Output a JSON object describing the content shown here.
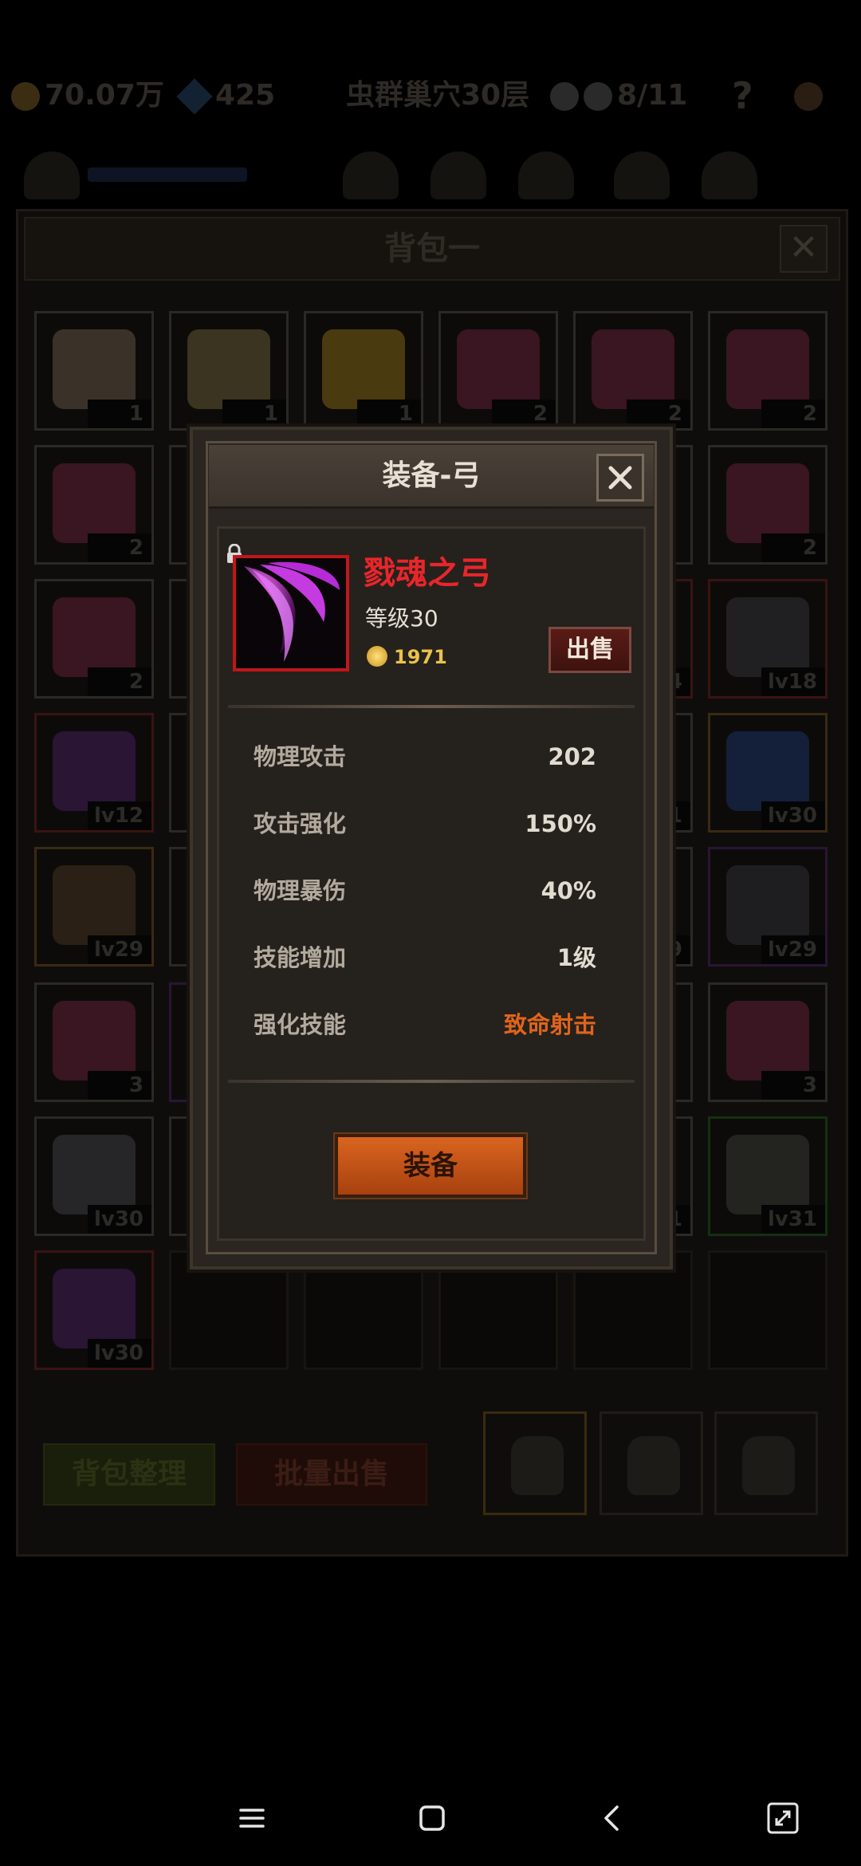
{
  "topbar": {
    "gold": "70.07万",
    "gems": "425",
    "location": "虫群巢穴30层",
    "kills": "8/11",
    "help": "?"
  },
  "bag": {
    "title": "背包一",
    "close": "✕",
    "slots": [
      {
        "badge": "1",
        "color": "#3a3128",
        "border": ""
      },
      {
        "badge": "1",
        "color": "#3a3420",
        "border": ""
      },
      {
        "badge": "1",
        "color": "#4a3a10",
        "border": ""
      },
      {
        "badge": "2",
        "color": "#3a1522",
        "border": ""
      },
      {
        "badge": "2",
        "color": "#3a1522",
        "border": ""
      },
      {
        "badge": "2",
        "color": "#3a1522",
        "border": ""
      },
      {
        "badge": "2",
        "color": "#3a1522",
        "border": ""
      },
      {
        "badge": "",
        "color": "#1a1410",
        "border": ""
      },
      {
        "badge": "",
        "color": "#1a1410",
        "border": ""
      },
      {
        "badge": "",
        "color": "#1a1410",
        "border": ""
      },
      {
        "badge": "",
        "color": "#1a1410",
        "border": ""
      },
      {
        "badge": "2",
        "color": "#3a1522",
        "border": ""
      },
      {
        "badge": "2",
        "color": "#3a1522",
        "border": ""
      },
      {
        "badge": "",
        "color": "#1a1410",
        "border": ""
      },
      {
        "badge": "",
        "color": "#1a1410",
        "border": ""
      },
      {
        "badge": "",
        "color": "#1a1410",
        "border": ""
      },
      {
        "badge": "4",
        "color": "#1a1410",
        "border": "red"
      },
      {
        "badge": "lv18",
        "color": "#202022",
        "border": "red"
      },
      {
        "badge": "lv12",
        "color": "#2a1535",
        "border": "red"
      },
      {
        "badge": "",
        "color": "#1a1410",
        "border": ""
      },
      {
        "badge": "",
        "color": "#1a1410",
        "border": ""
      },
      {
        "badge": "",
        "color": "#1a1410",
        "border": ""
      },
      {
        "badge": "1",
        "color": "#1a1410",
        "border": ""
      },
      {
        "badge": "lv30",
        "color": "#14203a",
        "border": "orange"
      },
      {
        "badge": "lv29",
        "color": "#2a2015",
        "border": "orange"
      },
      {
        "badge": "",
        "color": "#1a1410",
        "border": ""
      },
      {
        "badge": "",
        "color": "#1a1410",
        "border": ""
      },
      {
        "badge": "",
        "color": "#1a1410",
        "border": ""
      },
      {
        "badge": "9",
        "color": "#1a1410",
        "border": ""
      },
      {
        "badge": "lv29",
        "color": "#1e1e20",
        "border": "purple"
      },
      {
        "badge": "3",
        "color": "#3a1522",
        "border": ""
      },
      {
        "badge": "",
        "color": "#1a1410",
        "border": "purple"
      },
      {
        "badge": "",
        "color": "#1a1410",
        "border": ""
      },
      {
        "badge": "",
        "color": "#1a1410",
        "border": ""
      },
      {
        "badge": "",
        "color": "#1a1410",
        "border": ""
      },
      {
        "badge": "3",
        "color": "#3a1522",
        "border": ""
      },
      {
        "badge": "lv30",
        "color": "#262628",
        "border": ""
      },
      {
        "badge": "",
        "color": "#1a1410",
        "border": ""
      },
      {
        "badge": "",
        "color": "#1a1410",
        "border": ""
      },
      {
        "badge": "",
        "color": "#1a1410",
        "border": ""
      },
      {
        "badge": "1",
        "color": "#1a1410",
        "border": ""
      },
      {
        "badge": "lv31",
        "color": "#232320",
        "border": "green"
      },
      {
        "badge": "lv30",
        "color": "#2a1535",
        "border": "red"
      },
      {
        "badge": "",
        "color": "",
        "border": "empty"
      },
      {
        "badge": "",
        "color": "",
        "border": "empty"
      },
      {
        "badge": "",
        "color": "",
        "border": "empty"
      },
      {
        "badge": "",
        "color": "",
        "border": "empty"
      },
      {
        "badge": "",
        "color": "",
        "border": "empty"
      }
    ],
    "sort_label": "背包整理",
    "sell_all_label": "批量出售"
  },
  "modal": {
    "title": "装备-弓",
    "item": {
      "name": "戮魂之弓",
      "level": "等级30",
      "price": "1971",
      "sell_label": "出售"
    },
    "stats": [
      {
        "name": "物理攻击",
        "value": "202"
      },
      {
        "name": "攻击强化",
        "value": "150%"
      },
      {
        "name": "物理暴伤",
        "value": "40%"
      },
      {
        "name": "技能增加",
        "value": "1级"
      },
      {
        "name": "强化技能",
        "value": "致命射击"
      }
    ],
    "equip_label": "装备"
  },
  "colors": {
    "item_name": "#e8262a",
    "skill_highlight": "#e0651a",
    "equip_button": "#d9651f",
    "rarity_frame": "#c0161a"
  },
  "icons": [
    "lock-icon",
    "close-icon",
    "coin-icon",
    "menu-icon",
    "home-icon",
    "back-icon",
    "rotate-icon"
  ]
}
